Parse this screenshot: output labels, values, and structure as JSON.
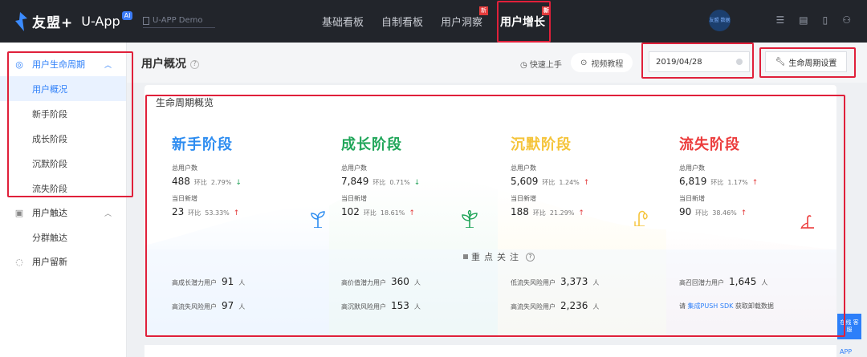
{
  "brand": {
    "name": "友盟+",
    "app": "U-App",
    "badge": "AI"
  },
  "app_selector": {
    "label": "U-APP Demo"
  },
  "nav": [
    {
      "label": "基础看板",
      "active": false,
      "hot": ""
    },
    {
      "label": "自制看板",
      "active": false,
      "hot": ""
    },
    {
      "label": "用户洞察",
      "active": false,
      "hot": "新"
    },
    {
      "label": "用户增长",
      "active": true,
      "hot": "新"
    }
  ],
  "top_avatar": "友盟 数据",
  "sidebar": {
    "groups": [
      {
        "label": "用户生命周期",
        "open": true,
        "items": [
          "用户概况",
          "新手阶段",
          "成长阶段",
          "沉默阶段",
          "流失阶段"
        ],
        "active_item": 0
      },
      {
        "label": "用户触达",
        "open": true,
        "items": [
          "分群触达"
        ]
      },
      {
        "label": "用户留新",
        "open": false,
        "items": []
      }
    ]
  },
  "header": {
    "title": "用户概况",
    "quick_start": "快速上手",
    "video_tutorial": "视频教程",
    "date": "2019/04/28",
    "cycle_settings": "生命周期设置"
  },
  "overview": {
    "title": "生命周期概览",
    "total_label": "总用户数",
    "new_label": "当日新增",
    "compare_label": "环比",
    "stages": [
      {
        "name": "新手阶段",
        "color": "#2d8cf0",
        "total": "488",
        "total_cmp": "2.79%",
        "total_trend": "down",
        "new": "23",
        "new_cmp": "53.33%",
        "new_trend": "up",
        "icon": "sprout-icon"
      },
      {
        "name": "成长阶段",
        "color": "#21a65a",
        "total": "7,849",
        "total_cmp": "0.71%",
        "total_trend": "down",
        "new": "102",
        "new_cmp": "18.61%",
        "new_trend": "up",
        "icon": "plant-icon"
      },
      {
        "name": "沉默阶段",
        "color": "#f5c43a",
        "total": "5,609",
        "total_cmp": "1.24%",
        "total_trend": "up",
        "new": "188",
        "new_cmp": "21.29%",
        "new_trend": "up",
        "icon": "bent-plant-icon"
      },
      {
        "name": "流失阶段",
        "color": "#ec3c3c",
        "total": "6,819",
        "total_cmp": "1.17%",
        "total_trend": "up",
        "new": "90",
        "new_cmp": "38.46%",
        "new_trend": "up",
        "icon": "wilted-plant-icon"
      }
    ]
  },
  "focus": {
    "title": "重点关注",
    "unit": "人",
    "items": [
      {
        "label": "高成长潜力用户",
        "value": "91"
      },
      {
        "label": "高流失风险用户",
        "value": "97"
      },
      {
        "label": "高价值潜力用户",
        "value": "360"
      },
      {
        "label": "高沉默风险用户",
        "value": "153"
      },
      {
        "label": "低流失风险用户",
        "value": "3,373"
      },
      {
        "label": "高流失风险用户",
        "value": "2,236"
      },
      {
        "label": "高召回潜力用户",
        "value": "1,645"
      }
    ],
    "tip_prefix": "请",
    "tip_link": "集成PUSH SDK",
    "tip_suffix": "获取卸载数据"
  },
  "float_button": "在线 客服",
  "float_app": "APP"
}
